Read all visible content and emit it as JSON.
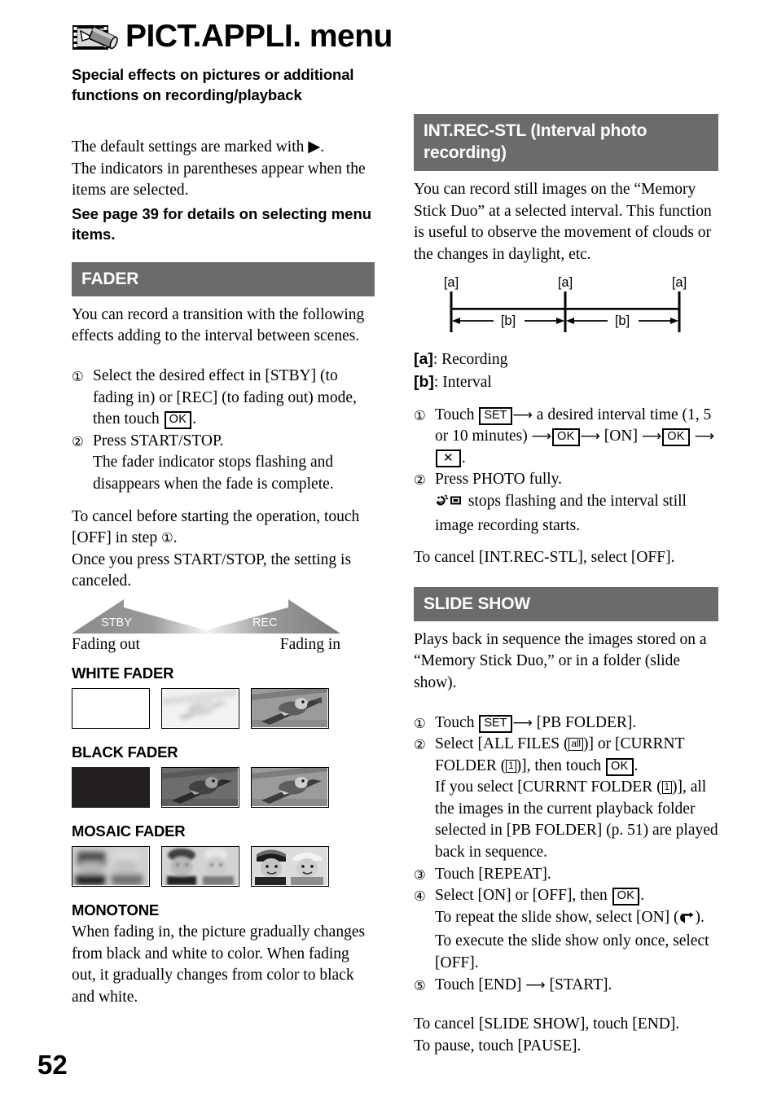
{
  "page": {
    "number": "52",
    "header": {
      "icon": "film-camcorder-icon",
      "title": "PICT.APPLI. menu",
      "subtitle": "Special effects on pictures or additional functions on recording/playback"
    }
  },
  "intro": {
    "line1": "The default settings are marked with ▶.",
    "line2": "The indicators in parentheses appear when the items are selected.",
    "bold_note": "See page 39 for details on selecting menu items."
  },
  "fader": {
    "heading": "FADER",
    "intro": "You can record a transition with the following effects adding to the interval between scenes.",
    "steps": [
      {
        "num": "①",
        "text_a": "Select the desired effect in [STBY] (to fading in) or [REC] (to fading out) mode, then touch ",
        "key": "OK",
        "text_b": "."
      },
      {
        "num": "②",
        "text_a": "Press START/STOP.",
        "sub": "The fader indicator stops flashing and disappears when the fade is complete."
      }
    ],
    "cancel_a": "To cancel before starting the operation, touch [OFF] in step ",
    "cancel_num": "①",
    "cancel_b": ".",
    "cancel_c": "Once you press START/STOP, the setting is canceled.",
    "diagram": {
      "left_tag": "STBY",
      "right_tag": "REC",
      "left_label": "Fading out",
      "right_label": "Fading in"
    },
    "samples": [
      {
        "heading": "WHITE FADER",
        "frames": [
          "white-blank",
          "bird-faded-white",
          "bird-full"
        ]
      },
      {
        "heading": "BLACK FADER",
        "frames": [
          "black-blank",
          "bird-dark",
          "bird-full"
        ]
      },
      {
        "heading": "MOSAIC FADER",
        "frames": [
          "kids-coarse-mosaic",
          "kids-fine-mosaic",
          "kids-full"
        ]
      }
    ],
    "monotone": {
      "heading": "MONOTONE",
      "text": "When fading in, the picture gradually changes from black and white to color. When fading out, it gradually changes from color to black and white."
    }
  },
  "int_rec_stl": {
    "heading": "INT.REC-STL (Interval photo recording)",
    "intro": "You can record still images on the “Memory Stick Duo” at a selected interval. This function is useful to observe the movement of clouds or the changes in daylight, etc.",
    "diagram": {
      "marks": [
        "[a]",
        "[a]",
        "[a]"
      ],
      "intervals": [
        "[b]",
        "[b]"
      ]
    },
    "legend_a_key": "[a]",
    "legend_a_val": ": Recording",
    "legend_b_key": "[b]",
    "legend_b_val": ": Interval",
    "steps": [
      {
        "num": "①",
        "p1": "Touch ",
        "k1": "SET",
        "p2": " a desired interval time (1, 5 or 10 minutes) ",
        "k2": "OK",
        "p3": " [ON] ",
        "k3": "OK",
        "k4": "✕",
        "p4": "."
      },
      {
        "num": "②",
        "p1": "Press PHOTO fully.",
        "sub_icon": "interval-rec-indicator",
        "sub": " stops flashing and the interval still image recording starts."
      }
    ],
    "cancel": "To cancel [INT.REC-STL], select [OFF]."
  },
  "slide_show": {
    "heading": "SLIDE SHOW",
    "intro": "Plays back in sequence the images stored on a “Memory Stick Duo,” or in a folder (slide show).",
    "steps": [
      {
        "num": "①",
        "p1": "Touch ",
        "k1": "SET",
        "p2": " [PB FOLDER]."
      },
      {
        "num": "②",
        "p1": "Select [ALL FILES (",
        "g1": "all",
        "p2": ")] or [CURRNT FOLDER (",
        "g2": "1",
        "p3": ")], then touch ",
        "k1": "OK",
        "p4": ".",
        "sub_p1": "If you select [CURRNT FOLDER (",
        "sub_g": "1",
        "sub_p2": ")], all the images in the current playback folder selected in [PB FOLDER] (p. 51) are played back in sequence."
      },
      {
        "num": "③",
        "p1": "Touch [REPEAT]."
      },
      {
        "num": "④",
        "p1": "Select [ON] or [OFF], then ",
        "k1": "OK",
        "p2": ".",
        "sub1_a": "To repeat the slide show, select [ON] (",
        "sub1_icon": "repeat-icon",
        "sub1_b": ").",
        "sub2": "To execute the slide show only once, select [OFF]."
      },
      {
        "num": "⑤",
        "p1": "Touch [END] ",
        "p2": " [START]."
      }
    ],
    "cancel1": "To cancel [SLIDE SHOW], touch [END].",
    "cancel2": "To pause, touch [PAUSE]."
  },
  "colors": {
    "section_bar": "#6b6b6b",
    "fade_gray": "#808080",
    "black_frame": "#231f20"
  }
}
